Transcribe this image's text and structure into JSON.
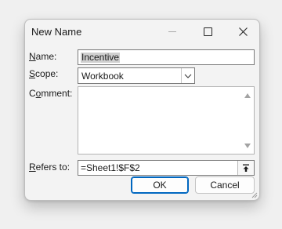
{
  "dialog": {
    "title": "New Name",
    "icons": {
      "minimize": "minimize-icon",
      "maximize": "maximize-icon",
      "close": "close-icon",
      "dropdown": "chevron-down-icon",
      "collapse": "collapse-dialog-icon",
      "resize": "resize-grip-icon"
    }
  },
  "form": {
    "name_label_key": "N",
    "name_label_rest": "ame:",
    "name_value": "Incentive",
    "scope_label_key": "S",
    "scope_label_rest": "cope:",
    "scope_value": "Workbook",
    "comment_label_first": "C",
    "comment_label_key": "o",
    "comment_label_rest": "mment:",
    "comment_value": "",
    "refers_label_key": "R",
    "refers_label_rest": "efers to:",
    "refers_value": "=Sheet1!$F$2"
  },
  "buttons": {
    "ok": "OK",
    "cancel": "Cancel"
  },
  "colors": {
    "accent": "#0067c0",
    "selection": "#cfcfcf"
  }
}
